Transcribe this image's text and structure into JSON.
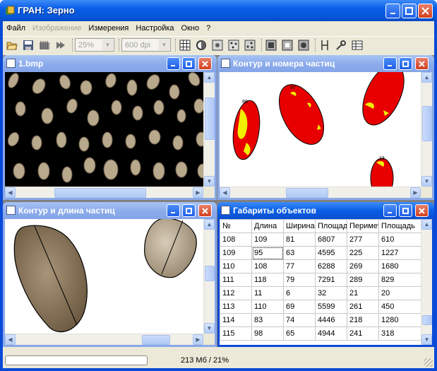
{
  "app": {
    "title": "ГРАН: Зерно"
  },
  "menu": [
    "Файл",
    "Изображение",
    "Измерения",
    "Настройка",
    "Окно",
    "?"
  ],
  "menu_disabled": [
    false,
    true,
    false,
    false,
    false,
    false
  ],
  "toolbar": {
    "zoom_value": "25%",
    "dpi_value": "600 dpi"
  },
  "windows": {
    "image": {
      "title": "1.bmp"
    },
    "contour_numbers": {
      "title": "Контур и номера частиц"
    },
    "contour_length": {
      "title": "Контур и длина частиц"
    },
    "dimensions": {
      "title": "Габариты объектов"
    }
  },
  "table": {
    "headers": [
      "№",
      "Длина",
      "Ширина",
      "Площадь",
      "Периметр",
      "Площадь"
    ],
    "rows": [
      [
        "108",
        "109",
        "81",
        "6807",
        "277",
        "610"
      ],
      [
        "109",
        "95",
        "63",
        "4595",
        "225",
        "1227"
      ],
      [
        "110",
        "108",
        "77",
        "6288",
        "269",
        "1680"
      ],
      [
        "111",
        "118",
        "79",
        "7291",
        "289",
        "829"
      ],
      [
        "112",
        "11",
        "6",
        "32",
        "21",
        "20"
      ],
      [
        "113",
        "110",
        "69",
        "5599",
        "261",
        "450"
      ],
      [
        "114",
        "83",
        "74",
        "4446",
        "218",
        "1280"
      ],
      [
        "115",
        "98",
        "65",
        "4944",
        "241",
        "318"
      ]
    ],
    "selected_cell": {
      "row": 1,
      "col": 1
    }
  },
  "status": {
    "memory": "213 Мб / 21%",
    "progress": 0
  },
  "colors": {
    "title_blue": "#0a5ee6",
    "particle_red": "#e80000",
    "particle_yellow": "#f0f000",
    "grain": "#b8a88c"
  }
}
